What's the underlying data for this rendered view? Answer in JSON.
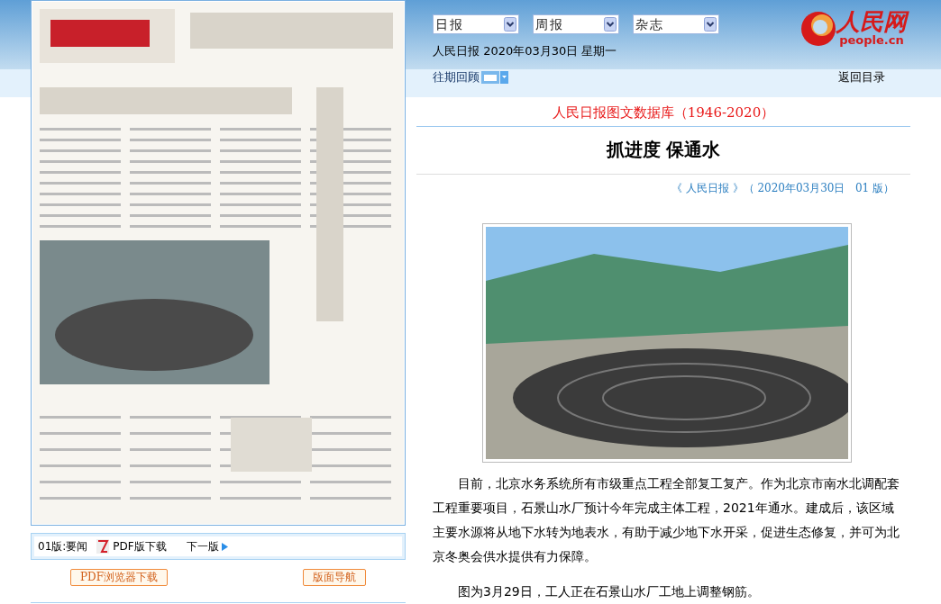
{
  "dropdowns": [
    {
      "value": "日报"
    },
    {
      "value": "周报"
    },
    {
      "value": "杂志"
    }
  ],
  "date_line": "人民日报 2020年03月30日 星期一",
  "logo": {
    "name": "人民网",
    "domain": "people.cn"
  },
  "nav": {
    "archive": "往期回顾",
    "back": "返回目录"
  },
  "database_title": "人民日报图文数据库（1946-2020）",
  "article": {
    "title": "抓进度 保通水",
    "source": "《 人民日报 》（ 2020年03月30日   01 版）",
    "paragraphs": [
      "目前，北京水务系统所有市级重点工程全部复工复产。作为北京市南水北调配套工程重要项目，石景山水厂预计今年完成主体工程，2021年通水。建成后，该区域主要水源将从地下水转为地表水，有助于减少地下水开采，促进生态修复，并可为北京冬奥会供水提供有力保障。",
      "图为3月29日，工人正在石景山水厂工地上调整钢筋。"
    ]
  },
  "page_bar": {
    "page": "01版:要闻",
    "pdf": "PDF版下载",
    "next": "下一版"
  },
  "buttons": [
    "PDF浏览器下载",
    "版面导航"
  ]
}
